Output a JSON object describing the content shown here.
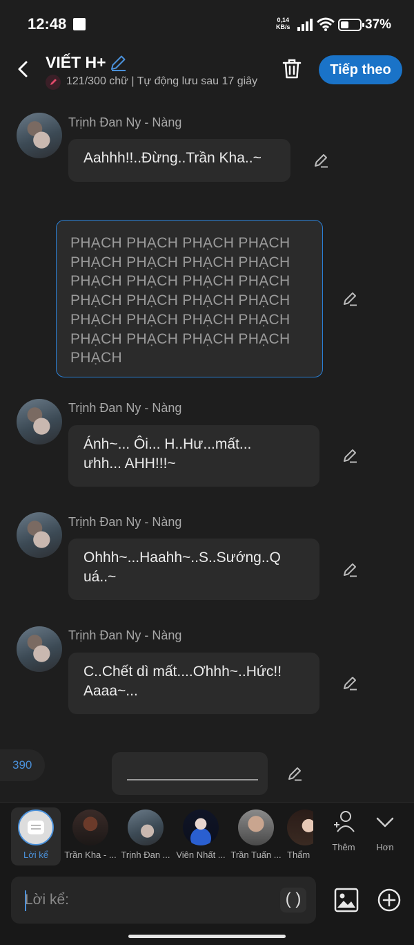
{
  "status": {
    "time": "12:48",
    "speed_value": "0,14",
    "speed_unit": "KB/s",
    "battery": "37%"
  },
  "header": {
    "title": "VIẾT H+",
    "subtitle": "121/300 chữ | Tự động lưu sau 17 giây",
    "next_label": "Tiếp theo"
  },
  "messages": [
    {
      "speaker": "Trịnh Đan Ny - Nàng",
      "text": "Aahhh!!..Đừng..Trần Kha..~"
    },
    {
      "speaker": "Trịnh Đan Ny - Nàng",
      "line1": "Ánh~... Ôi... H..Hư...mất...",
      "line2": "ưhh... AHH!!!~"
    },
    {
      "speaker": "Trịnh Đan Ny - Nàng",
      "line1": "Ohhh~...Haahh~..S..Sướng..Q",
      "line2": "uá..~"
    },
    {
      "speaker": "Trịnh Đan Ny - Nàng",
      "line1": "C..Chết dì mất....Ơhhh~..Hức!!",
      "line2": "Aaaa~..."
    }
  ],
  "narration": {
    "lines": [
      "PHẠCH PHẠCH PHẠCH PHẠCH",
      "PHẠCH PHẠCH PHẠCH PHẠCH",
      "PHẠCH PHẠCH PHẠCH PHẠCH",
      "PHẠCH PHẠCH PHẠCH PHẠCH",
      "PHẠCH PHẠCH PHẠCH PHẠCH",
      "PHẠCH PHẠCH PHẠCH PHẠCH",
      "PHẠCH"
    ]
  },
  "counter": "390",
  "characters": [
    {
      "name": "Lời kể",
      "selected": true
    },
    {
      "name": "Trần Kha - ..."
    },
    {
      "name": "Trịnh Đan ..."
    },
    {
      "name": "Viên Nhất ..."
    },
    {
      "name": "Trần Tuấn ..."
    },
    {
      "name": "Thẩm"
    }
  ],
  "actions": {
    "add": "Thêm",
    "more": "Hơn"
  },
  "input": {
    "placeholder": "Lời kể:",
    "paren": "( )"
  },
  "colors": {
    "accent": "#1a73c8",
    "background": "#1e1e1e",
    "bubble": "#2b2b2b",
    "selected_text": "#4a90d9"
  },
  "icons": [
    "back-icon",
    "pen-icon",
    "trash-icon",
    "edit-icon",
    "person-add-icon",
    "chevron-down-icon",
    "image-icon",
    "plus-circle-icon"
  ]
}
